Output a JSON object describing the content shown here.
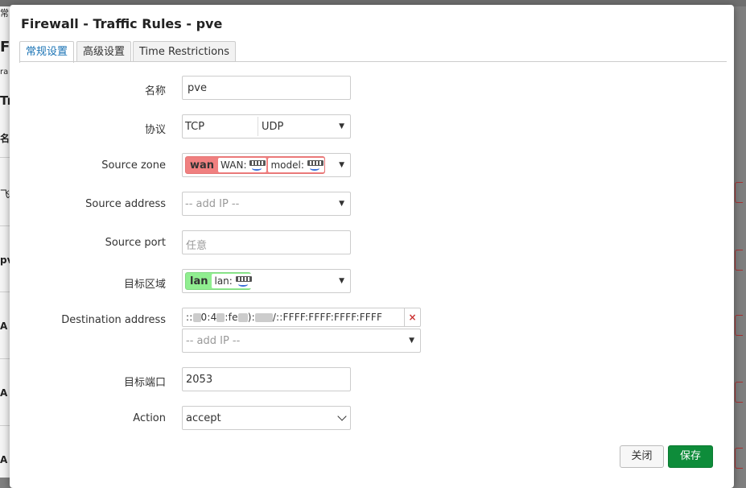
{
  "modal": {
    "title": "Firewall - Traffic Rules - pve",
    "tabs": [
      {
        "label": "常规设置",
        "active": true
      },
      {
        "label": "高级设置",
        "active": false
      },
      {
        "label": "Time Restrictions",
        "active": false
      }
    ]
  },
  "form": {
    "name": {
      "label": "名称",
      "value": "pve"
    },
    "protocol": {
      "label": "协议",
      "value_a": "TCP",
      "value_b": "UDP"
    },
    "source_zone": {
      "label": "Source zone",
      "zone": "wan",
      "devices": [
        "WAN:",
        "model:"
      ],
      "color": "#f08080"
    },
    "source_address": {
      "label": "Source address",
      "placeholder": "-- add IP --"
    },
    "source_port": {
      "label": "Source port",
      "placeholder": "任意"
    },
    "dest_zone": {
      "label": "目标区域",
      "zone": "lan",
      "devices": [
        "lan:"
      ],
      "color": "#90ee90"
    },
    "dest_address": {
      "label": "Destination address",
      "value_start": "::",
      "value_mid1": "0:4",
      "value_mid2": ":fe",
      "value_mid3": "):",
      "value_end": "/::FFFF:FFFF:FFFF:FFFF",
      "add_placeholder": "-- add IP --",
      "remove_icon": "×"
    },
    "dest_port": {
      "label": "目标端口",
      "value": "2053"
    },
    "action": {
      "label": "Action",
      "value": "accept"
    }
  },
  "footer": {
    "close_label": "关闭",
    "save_label": "保存",
    "save_color": "#0e8c3a"
  },
  "background": {
    "fragments": [
      "常",
      "Fi",
      "ra",
      "Tr",
      "名",
      "飞",
      "pv",
      "A",
      "A",
      "A"
    ]
  }
}
